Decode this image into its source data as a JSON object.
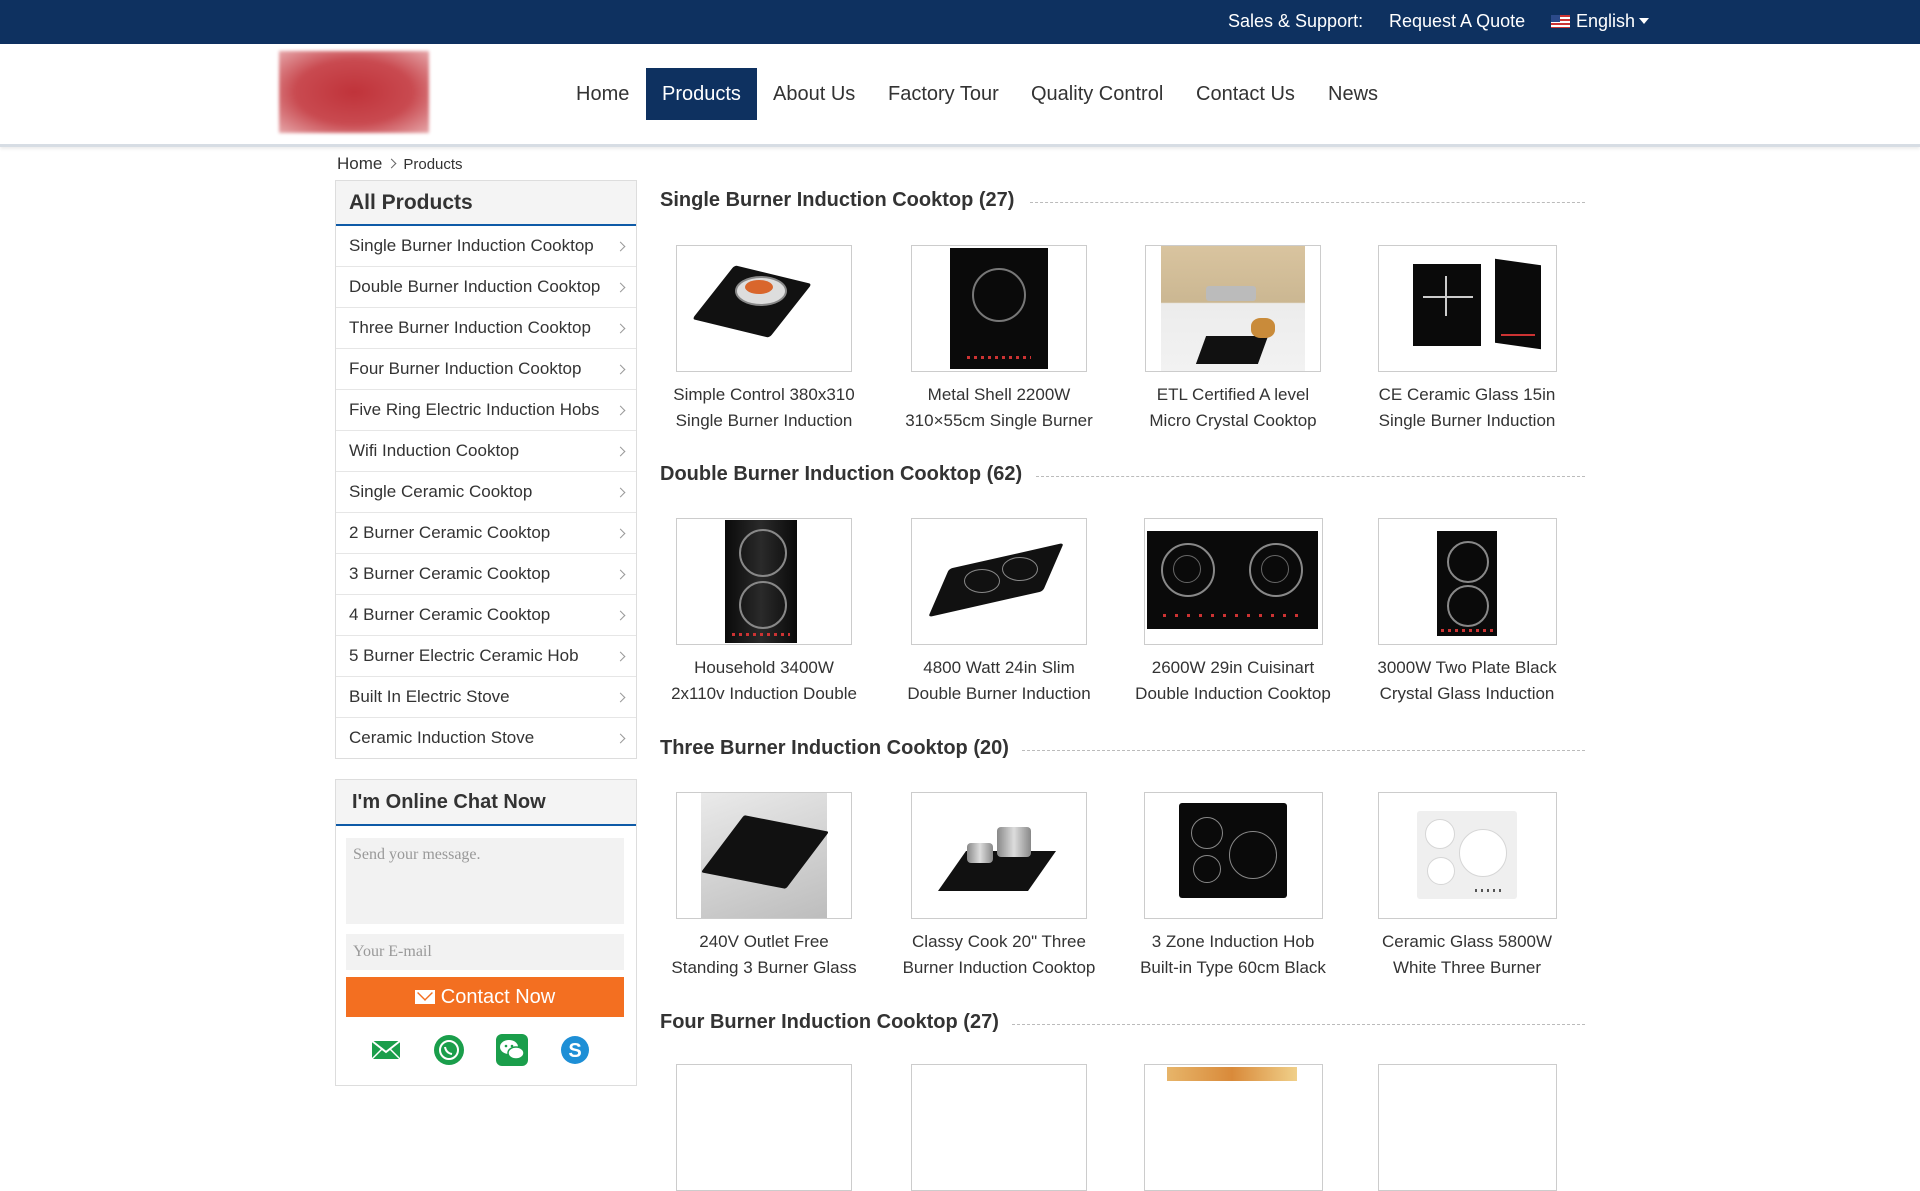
{
  "topbar": {
    "sales": "Sales & Support:",
    "quote": "Request A Quote",
    "language": "English"
  },
  "nav": [
    "Home",
    "Products",
    "About Us",
    "Factory Tour",
    "Quality Control",
    "Contact Us",
    "News"
  ],
  "nav_active": "Products",
  "breadcrumb": {
    "home": "Home",
    "current": "Products"
  },
  "sidebar": {
    "title": "All Products",
    "items": [
      "Single Burner Induction Cooktop",
      "Double Burner Induction Cooktop",
      "Three Burner Induction Cooktop",
      "Four Burner Induction Cooktop",
      "Five Ring Electric Induction Hobs",
      "Wifi Induction Cooktop",
      "Single Ceramic Cooktop",
      "2 Burner Ceramic Cooktop",
      "3 Burner Ceramic Cooktop",
      "4 Burner Ceramic Cooktop",
      "5 Burner Electric Ceramic Hob",
      "Built In Electric Stove",
      "Ceramic Induction Stove"
    ]
  },
  "chat": {
    "title": "I'm Online Chat Now",
    "message_placeholder": "Send your message.",
    "email_placeholder": "Your E-mail",
    "button": "Contact Now",
    "socials": [
      "email-icon",
      "whatsapp-icon",
      "wechat-icon",
      "skype-icon"
    ]
  },
  "sections": [
    {
      "title": "Single Burner Induction Cooktop (27)",
      "products": [
        {
          "l1": "Simple Control 380x310",
          "l2": "Single Burner Induction",
          "img": "single-pan"
        },
        {
          "l1": "Metal Shell 2200W",
          "l2": "310×55cm Single Burner",
          "img": "single-vertical"
        },
        {
          "l1": "ETL Certified A level",
          "l2": "Micro Crystal Cooktop",
          "img": "kitchen"
        },
        {
          "l1": "CE Ceramic Glass 15in",
          "l2": "Single Burner Induction",
          "img": "single-two-views"
        }
      ]
    },
    {
      "title": "Double Burner Induction Cooktop (62)",
      "products": [
        {
          "l1": "Household 3400W",
          "l2": "2x110v Induction Double",
          "img": "double-vertical"
        },
        {
          "l1": "4800 Watt 24in Slim",
          "l2": "Double Burner Induction",
          "img": "double-angled"
        },
        {
          "l1": "2600W 29in Cuisinart",
          "l2": "Double Induction Cooktop",
          "img": "double-wide"
        },
        {
          "l1": "3000W Two Plate Black",
          "l2": "Crystal Glass Induction",
          "img": "double-narrow"
        }
      ]
    },
    {
      "title": "Three Burner Induction Cooktop (20)",
      "products": [
        {
          "l1": "240V Outlet Free",
          "l2": "Standing 3 Burner Glass",
          "img": "three-gray"
        },
        {
          "l1": "Classy Cook 20\" Three",
          "l2": "Burner Induction Cooktop",
          "img": "three-pots"
        },
        {
          "l1": "3 Zone Induction Hob",
          "l2": "Built-in Type 60cm Black",
          "img": "three-black"
        },
        {
          "l1": "Ceramic Glass 5800W",
          "l2": "White Three Burner",
          "img": "three-white"
        }
      ]
    },
    {
      "title": "Four Burner Induction Cooktop (27)",
      "products": [
        {
          "l1": "",
          "l2": "",
          "img": "blank"
        },
        {
          "l1": "",
          "l2": "",
          "img": "blank"
        },
        {
          "l1": "",
          "l2": "",
          "img": "food"
        },
        {
          "l1": "",
          "l2": "",
          "img": "blank"
        }
      ]
    }
  ],
  "colors": {
    "brand": "#0e3160",
    "accent": "#f36f21",
    "underline": "#0e5aa7"
  }
}
